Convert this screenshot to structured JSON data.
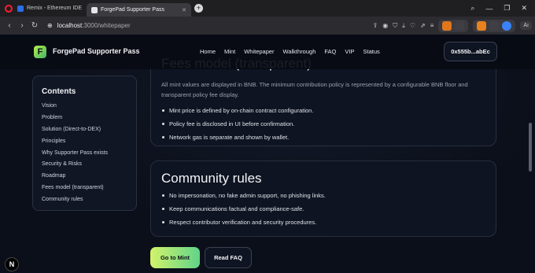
{
  "browser": {
    "tabs": [
      {
        "title": "Remix - Ethereum IDE"
      },
      {
        "title": "ForgePad Supporter Pass"
      }
    ],
    "url_host": "localhost",
    "url_path": ":3000/whitepaper",
    "new_tab": "+",
    "ai_label": "Aı"
  },
  "site": {
    "logo_letter": "F",
    "brand": "ForgePad Supporter Pass",
    "nav": [
      "Home",
      "Mint",
      "Whitepaper",
      "Walkthrough",
      "FAQ",
      "VIP",
      "Status"
    ],
    "wallet": "0x555b...abEc"
  },
  "toc": {
    "title": "Contents",
    "items": [
      "Vision",
      "Problem",
      "Solution (Direct-to-DEX)",
      "Principles",
      "Why Supporter Pass exists",
      "Security & Risks",
      "Roadmap",
      "Fees model (transparent)",
      "Community rules"
    ]
  },
  "fees": {
    "title": "Fees model (transparent)",
    "paragraph": "All mint values are displayed in BNB. The minimum contribution policy is represented by a configurable BNB floor and transparent policy fee display.",
    "bullets": [
      "Mint price is defined by on-chain contract configuration.",
      "Policy fee is disclosed in UI before confirmation.",
      "Network gas is separate and shown by wallet."
    ]
  },
  "community": {
    "title": "Community rules",
    "bullets": [
      "No impersonation, no fake admin support, no phishing links.",
      "Keep communications factual and compliance-safe.",
      "Respect contributor verification and security procedures."
    ]
  },
  "actions": {
    "mint": "Go to Mint",
    "faq": "Read FAQ"
  },
  "dev": {
    "badge": "N"
  }
}
